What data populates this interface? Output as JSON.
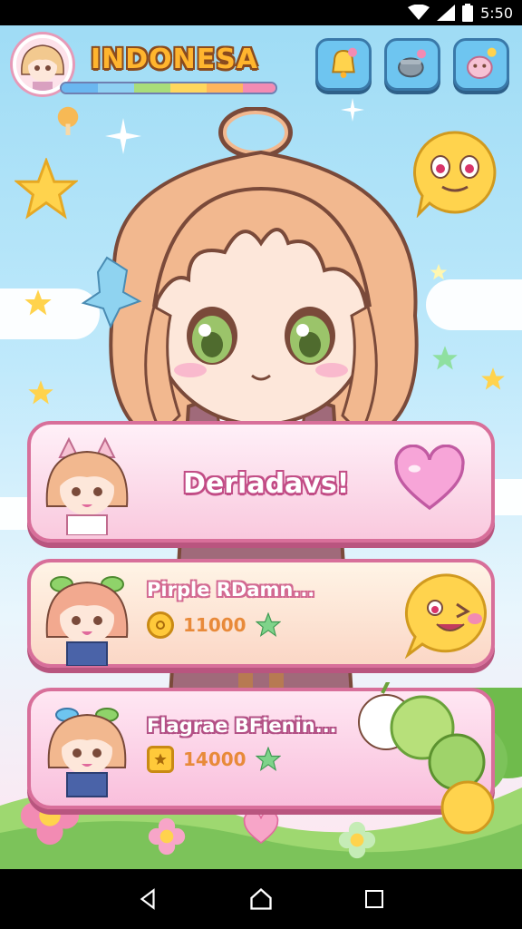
{
  "status_bar": {
    "time": "5:50"
  },
  "header": {
    "title": "INDONESA",
    "xp_colors": [
      "#6ab7f0",
      "#8fd0f2",
      "#a9dd7a",
      "#ffd75e",
      "#ffb55e",
      "#f28bb3"
    ]
  },
  "top_buttons": [
    {
      "icon": "bell-icon"
    },
    {
      "icon": "pot-icon"
    },
    {
      "icon": "pet-icon"
    }
  ],
  "cards": [
    {
      "title": "Deriadavs!"
    },
    {
      "title": "Pirple RDamn...",
      "reward_value": "11000"
    },
    {
      "title": "Flagrae BFienin...",
      "reward_value": "14000"
    }
  ],
  "colors": {
    "accent_pink": "#d86f9a",
    "title_orange": "#ffb52e",
    "button_blue": "#6ec5f0"
  }
}
